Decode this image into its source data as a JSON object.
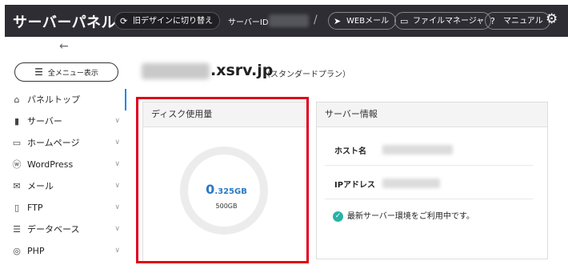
{
  "header": {
    "title": "サーバーパネル",
    "old_design": "旧デザインに切り替え",
    "server_id_label": "サーバーID",
    "separator": "/",
    "webmail": "WEBメール",
    "file_manager": "ファイルマネージャ",
    "manual": "マニュアル"
  },
  "sidebar": {
    "back_arrow": "←",
    "menu_button": "全メニュー表示",
    "items": [
      {
        "label": "パネルトップ",
        "icon": "home-icon"
      },
      {
        "label": "サーバー",
        "icon": "server-icon"
      },
      {
        "label": "ホームページ",
        "icon": "window-icon"
      },
      {
        "label": "WordPress",
        "icon": "wordpress-icon"
      },
      {
        "label": "メール",
        "icon": "mail-icon"
      },
      {
        "label": "FTP",
        "icon": "monitor-icon"
      },
      {
        "label": "データベース",
        "icon": "database-icon"
      },
      {
        "label": "PHP",
        "icon": "php-icon"
      }
    ]
  },
  "main": {
    "domain_suffix": ".xsrv.jp",
    "plan": "（スタンダードプラン）",
    "disk_card": {
      "title": "ディスク使用量",
      "used_int": "0",
      "used_frac": ".325GB",
      "total": "500GB"
    },
    "server_info": {
      "title": "サーバー情報",
      "host_label": "ホスト名",
      "ip_label": "IPアドレス",
      "status": "最新サーバー環境をご利用中です。"
    }
  },
  "colors": {
    "topbar": "#2d2d33",
    "accent_blue": "#1e88e5",
    "highlight_red": "#e0001a",
    "status_check": "#27b3a6"
  }
}
